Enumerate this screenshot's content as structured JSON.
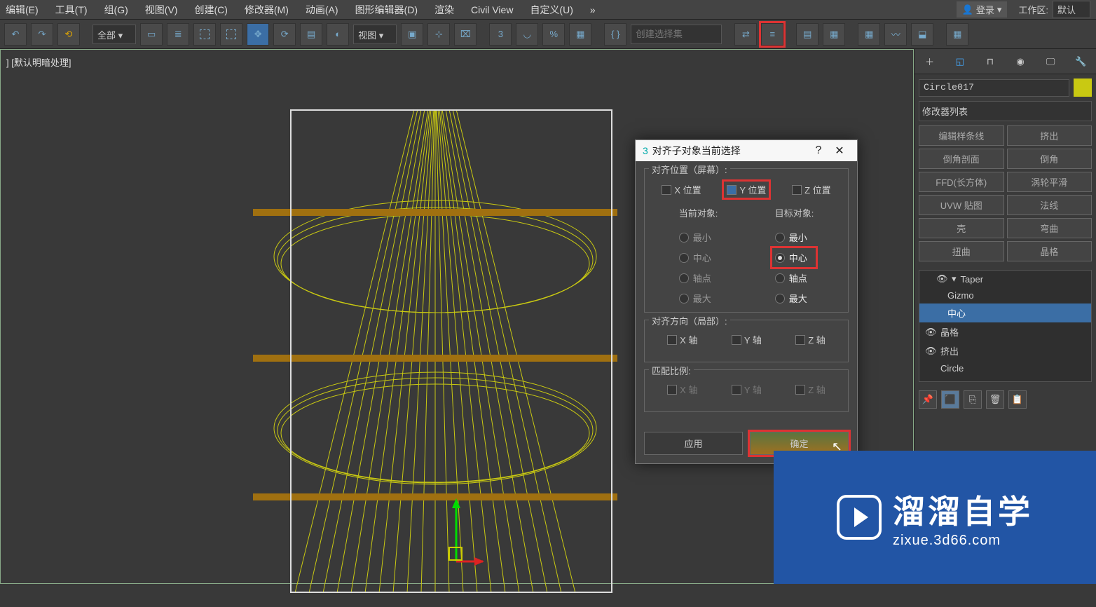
{
  "menubar": [
    "编辑(E)",
    "工具(T)",
    "组(G)",
    "视图(V)",
    "创建(C)",
    "修改器(M)",
    "动画(A)",
    "图形编辑器(D)",
    "渲染",
    "Civil View",
    "自定义(U)"
  ],
  "login": {
    "label": "登录",
    "workspace_label": "工作区:",
    "workspace_value": "默认"
  },
  "toolbar": {
    "scope_select": "全部",
    "coord_select": "视图",
    "named_sel_placeholder": "创建选择集"
  },
  "viewport": {
    "label": "] [默认明暗处理]"
  },
  "side": {
    "object_name": "Circle017",
    "mod_list_label": "修改器列表",
    "mod_buttons": [
      "编辑样条线",
      "挤出",
      "倒角剖面",
      "倒角",
      "FFD(长方体)",
      "涡轮平滑",
      "UVW 贴图",
      "法线",
      "壳",
      "弯曲",
      "扭曲",
      "晶格"
    ],
    "stack": {
      "taper": "Taper",
      "gizmo": "Gizmo",
      "center": "中心",
      "lattice": "晶格",
      "extrude": "挤出",
      "circle": "Circle"
    }
  },
  "dialog": {
    "title": "对齐子对象当前选择",
    "help": "?",
    "close": "✕",
    "pos_group": "对齐位置（屏幕）:",
    "x_pos": "X 位置",
    "y_pos": "Y 位置",
    "z_pos": "Z 位置",
    "current_col": "当前对象:",
    "target_col": "目标对象:",
    "opt_min": "最小",
    "opt_center": "中心",
    "opt_pivot": "轴点",
    "opt_max": "最大",
    "dir_group": "对齐方向（局部）:",
    "x_axis": "X 轴",
    "y_axis": "Y 轴",
    "z_axis": "Z 轴",
    "scale_group": "匹配比例:",
    "apply": "应用",
    "ok": "确定"
  },
  "watermark": {
    "name": "溜溜自学",
    "url": "zixue.3d66.com"
  }
}
